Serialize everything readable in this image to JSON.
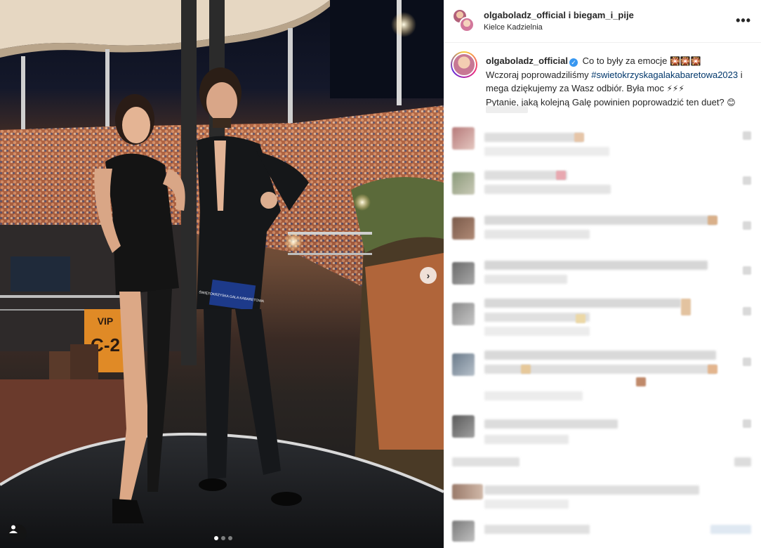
{
  "photo": {
    "description_icon": "user-tag-icon",
    "next_icon": "chevron-right-icon",
    "sign_vip": "VIP",
    "sign_sector": "C-2",
    "card_text": "ŚWIĘTOKRZYSKA GALA KABARETOWA",
    "carousel_count": 3,
    "carousel_active": 1
  },
  "header": {
    "authors": "olgaboladz_official i biegam_i_pije",
    "location": "Kielce Kadzielnia",
    "more_icon": "more-options-icon",
    "more_label": "•••"
  },
  "caption": {
    "username": "olgaboladz_official",
    "verified_icon": "verified-badge-icon",
    "line1": "Co to były za emocje",
    "line1_emoji": "🎇🎇🎇",
    "line2_pre": "Wczoraj poprowadziliśmy ",
    "hashtag": "#swietokrzyskagalakabaretowa2023",
    "line2_post": " i mega dziękujemy za Wasz odbiór. Była moc",
    "line2_emoji": "⚡⚡⚡",
    "line3": "Pytanie, jaką kolejną Galę powinien poprowadzić ten duet?",
    "line3_emoji": "😊"
  },
  "colors": {
    "accent_blue": "#3897f0",
    "hashtag": "#00376b",
    "text": "#262626",
    "border": "#efefef"
  }
}
